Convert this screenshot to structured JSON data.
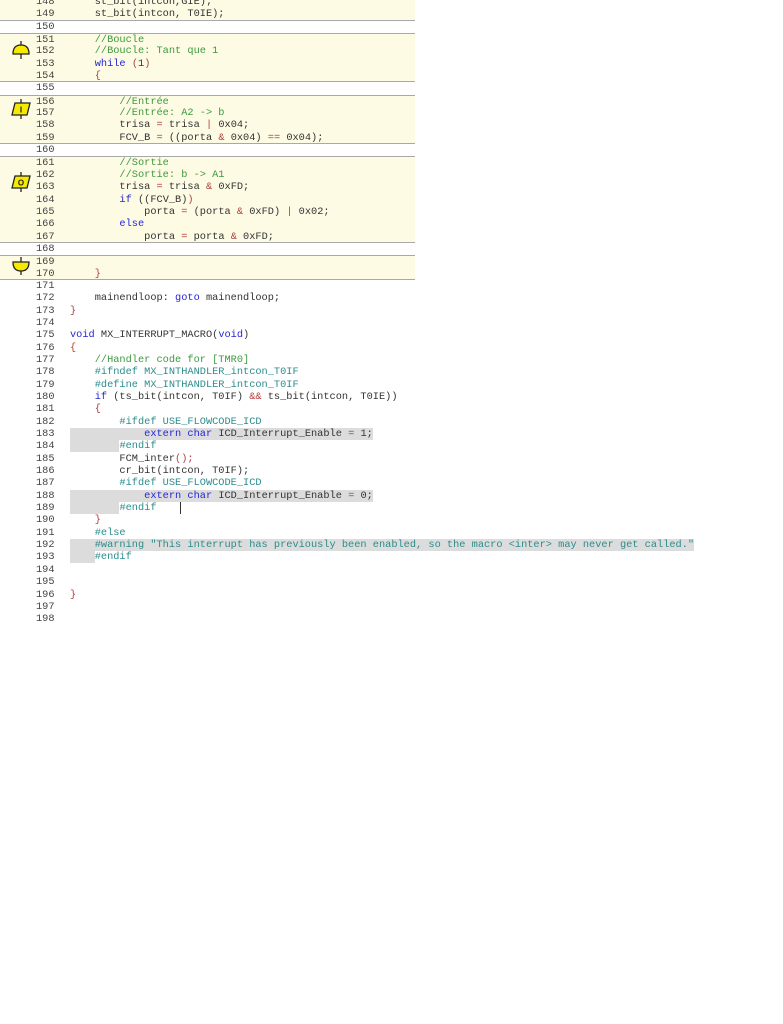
{
  "editor": {
    "blocks": [
      {
        "from": 148,
        "to": 149,
        "icon": null
      },
      {
        "from": 151,
        "to": 154,
        "icon": "loop-start"
      },
      {
        "from": 156,
        "to": 159,
        "icon": "input"
      },
      {
        "from": 161,
        "to": 167,
        "icon": "output"
      },
      {
        "from": 169,
        "to": 170,
        "icon": "loop-end"
      }
    ],
    "icon_labels": {
      "input": "I",
      "output": "O"
    },
    "lines": [
      {
        "n": "148",
        "tk": [
          [
            "t",
            "    st_bit(intcon,GIE);"
          ]
        ]
      },
      {
        "n": "149",
        "tk": [
          [
            "t",
            "    st_bit(intcon, T0IE);"
          ]
        ]
      },
      {
        "n": "150",
        "tk": []
      },
      {
        "n": "151",
        "tk": [
          [
            "c",
            "    //Boucle"
          ]
        ]
      },
      {
        "n": "152",
        "tk": [
          [
            "c",
            "    //Boucle: Tant que 1"
          ]
        ]
      },
      {
        "n": "153",
        "tk": [
          [
            "k",
            "    while"
          ],
          [
            "t",
            " "
          ],
          [
            "o",
            "("
          ],
          [
            "t",
            "1"
          ],
          [
            "o",
            ")"
          ]
        ]
      },
      {
        "n": "154",
        "tk": [
          [
            "o",
            "    {"
          ]
        ]
      },
      {
        "n": "155",
        "tk": []
      },
      {
        "n": "156",
        "tk": [
          [
            "c",
            "        //Entrée"
          ]
        ]
      },
      {
        "n": "157",
        "tk": [
          [
            "c",
            "        //Entrée: A2 -> b"
          ]
        ]
      },
      {
        "n": "158",
        "tk": [
          [
            "t",
            "        trisa "
          ],
          [
            "o",
            "="
          ],
          [
            "t",
            " trisa "
          ],
          [
            "o",
            "|"
          ],
          [
            "t",
            " 0x04;"
          ]
        ]
      },
      {
        "n": "159",
        "tk": [
          [
            "t",
            "        FCV_B "
          ],
          [
            "o",
            "="
          ],
          [
            "t",
            " ((porta "
          ],
          [
            "o",
            "&"
          ],
          [
            "t",
            " 0x04) "
          ],
          [
            "o",
            "=="
          ],
          [
            "t",
            " 0x04);"
          ]
        ]
      },
      {
        "n": "160",
        "tk": []
      },
      {
        "n": "161",
        "tk": [
          [
            "c",
            "        //Sortie"
          ]
        ]
      },
      {
        "n": "162",
        "tk": [
          [
            "c",
            "        //Sortie: b -> A1"
          ]
        ]
      },
      {
        "n": "163",
        "tk": [
          [
            "t",
            "        trisa "
          ],
          [
            "o",
            "="
          ],
          [
            "t",
            " trisa "
          ],
          [
            "o",
            "&"
          ],
          [
            "t",
            " 0xFD;"
          ]
        ]
      },
      {
        "n": "164",
        "tk": [
          [
            "k",
            "        if"
          ],
          [
            "t",
            " ((FCV_B)"
          ],
          [
            "o",
            ")"
          ]
        ]
      },
      {
        "n": "165",
        "tk": [
          [
            "t",
            "            porta "
          ],
          [
            "o",
            "="
          ],
          [
            "t",
            " (porta "
          ],
          [
            "o",
            "&"
          ],
          [
            "t",
            " 0xFD) "
          ],
          [
            "o",
            "|"
          ],
          [
            "t",
            " 0x02;"
          ]
        ]
      },
      {
        "n": "166",
        "tk": [
          [
            "k",
            "        else"
          ]
        ]
      },
      {
        "n": "167",
        "tk": [
          [
            "t",
            "            porta "
          ],
          [
            "o",
            "="
          ],
          [
            "t",
            " porta "
          ],
          [
            "o",
            "&"
          ],
          [
            "t",
            " 0xFD;"
          ]
        ]
      },
      {
        "n": "168",
        "tk": []
      },
      {
        "n": "169",
        "tk": []
      },
      {
        "n": "170",
        "tk": [
          [
            "o",
            "    }"
          ]
        ]
      },
      {
        "n": "171",
        "tk": []
      },
      {
        "n": "172",
        "tk": [
          [
            "t",
            "    mainendloop: "
          ],
          [
            "k",
            "goto"
          ],
          [
            "t",
            " mainendloop;"
          ]
        ]
      },
      {
        "n": "173",
        "tk": [
          [
            "o",
            "}"
          ]
        ]
      },
      {
        "n": "174",
        "tk": []
      },
      {
        "n": "175",
        "tk": [
          [
            "k",
            "void"
          ],
          [
            "t",
            " MX_INTERRUPT_MACRO("
          ],
          [
            "k",
            "void"
          ],
          [
            "t",
            ")"
          ]
        ]
      },
      {
        "n": "176",
        "tk": [
          [
            "o",
            "{"
          ]
        ]
      },
      {
        "n": "177",
        "tk": [
          [
            "c",
            "    //Handler code for [TMR0]"
          ]
        ]
      },
      {
        "n": "178",
        "tk": [
          [
            "p",
            "    #ifndef MX_INTHANDLER_intcon_T0IF"
          ]
        ]
      },
      {
        "n": "179",
        "tk": [
          [
            "p",
            "    #define MX_INTHANDLER_intcon_T0IF"
          ]
        ]
      },
      {
        "n": "180",
        "tk": [
          [
            "k",
            "    if"
          ],
          [
            "t",
            " (ts_bit(intcon, T0IF) "
          ],
          [
            "o",
            "&&"
          ],
          [
            "t",
            " ts_bit(intcon, T0IE))"
          ]
        ]
      },
      {
        "n": "181",
        "tk": [
          [
            "o",
            "    {"
          ]
        ]
      },
      {
        "n": "182",
        "tk": [
          [
            "p",
            "        #ifdef USE_FLOWCODE_ICD"
          ]
        ]
      },
      {
        "n": "183",
        "hl": "full",
        "tk": [
          [
            "k",
            "            extern"
          ],
          [
            "t",
            " "
          ],
          [
            "k",
            "char"
          ],
          [
            "t",
            " ICD_Interrupt_Enable "
          ],
          [
            "o",
            "="
          ],
          [
            "t",
            " 1;"
          ]
        ]
      },
      {
        "n": "184",
        "hl": "indent",
        "tk": [
          [
            "t",
            "        "
          ],
          [
            "p",
            "#endif"
          ]
        ]
      },
      {
        "n": "185",
        "tk": [
          [
            "t",
            "        FCM_inter"
          ],
          [
            "o",
            "();"
          ]
        ]
      },
      {
        "n": "186",
        "tk": [
          [
            "t",
            "        cr_bit(intcon, T0IF);"
          ]
        ]
      },
      {
        "n": "187",
        "tk": [
          [
            "p",
            "        #ifdef USE_FLOWCODE_ICD"
          ]
        ]
      },
      {
        "n": "188",
        "hl": "full",
        "tk": [
          [
            "k",
            "            extern"
          ],
          [
            "t",
            " "
          ],
          [
            "k",
            "char"
          ],
          [
            "t",
            " ICD_Interrupt_Enable "
          ],
          [
            "o",
            "="
          ],
          [
            "t",
            " 0;"
          ]
        ]
      },
      {
        "n": "189",
        "hl": "indent",
        "cursor": true,
        "tk": [
          [
            "t",
            "        "
          ],
          [
            "p",
            "#endif"
          ]
        ]
      },
      {
        "n": "190",
        "tk": [
          [
            "o",
            "    }"
          ]
        ]
      },
      {
        "n": "191",
        "tk": [
          [
            "p",
            "    #else"
          ]
        ]
      },
      {
        "n": "192",
        "hl": "full",
        "tk": [
          [
            "p",
            "    #warning \"This interrupt has previously been enabled, so the macro <inter> may never get called.\""
          ]
        ]
      },
      {
        "n": "193",
        "hl": "indent",
        "tk": [
          [
            "t",
            "    "
          ],
          [
            "p",
            "#endif"
          ]
        ]
      },
      {
        "n": "194",
        "tk": []
      },
      {
        "n": "195",
        "tk": []
      },
      {
        "n": "196",
        "tk": [
          [
            "o",
            "}"
          ]
        ]
      },
      {
        "n": "197",
        "tk": []
      },
      {
        "n": "198",
        "tk": []
      }
    ]
  }
}
